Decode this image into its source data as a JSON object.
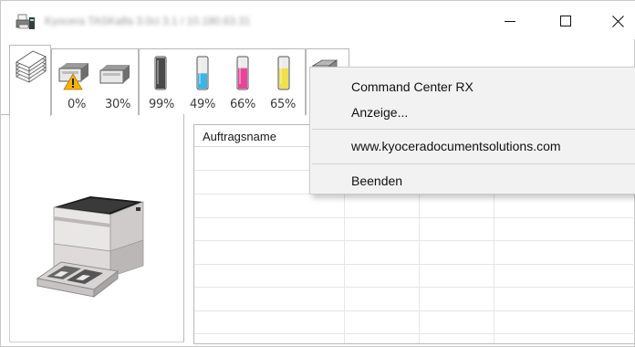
{
  "window": {
    "title": "Kyocera TASKalfa 3.0ci 3.1 / 10.180.63.31"
  },
  "title_bar": {
    "minimize_glyph": "—",
    "maximize_glyph": "☐",
    "close_glyph": "✕"
  },
  "tabs": {
    "jobs": {
      "icon": "document-stack-icon"
    },
    "paper": {
      "trays": [
        {
          "icon": "paper-tray-warning-icon",
          "level_label": "0%",
          "level": 0
        },
        {
          "icon": "paper-tray-icon",
          "level_label": "30%",
          "level": 30
        }
      ]
    },
    "toner": {
      "cartridges": [
        {
          "color_name": "black",
          "color": "#4a4a4a",
          "level_label": "99%",
          "level": 99
        },
        {
          "color_name": "cyan",
          "color": "#3db4e6",
          "level_label": "49%",
          "level": 49
        },
        {
          "color_name": "magenta",
          "color": "#e8459a",
          "level_label": "66%",
          "level": 66
        },
        {
          "color_name": "yellow",
          "color": "#f0e04a",
          "level_label": "65%",
          "level": 65
        }
      ]
    },
    "device": {
      "icon": "printer-device-icon"
    }
  },
  "settings": {
    "icon": "gear-icon"
  },
  "job_table": {
    "columns": [
      "Auftragsname",
      "",
      "",
      ""
    ],
    "rows": []
  },
  "context_menu": {
    "items": [
      {
        "label": "Command Center RX"
      },
      {
        "label": "Anzeige..."
      },
      {
        "label": "www.kyoceradocumentsolutions.com"
      },
      {
        "label": "Beenden"
      }
    ]
  }
}
